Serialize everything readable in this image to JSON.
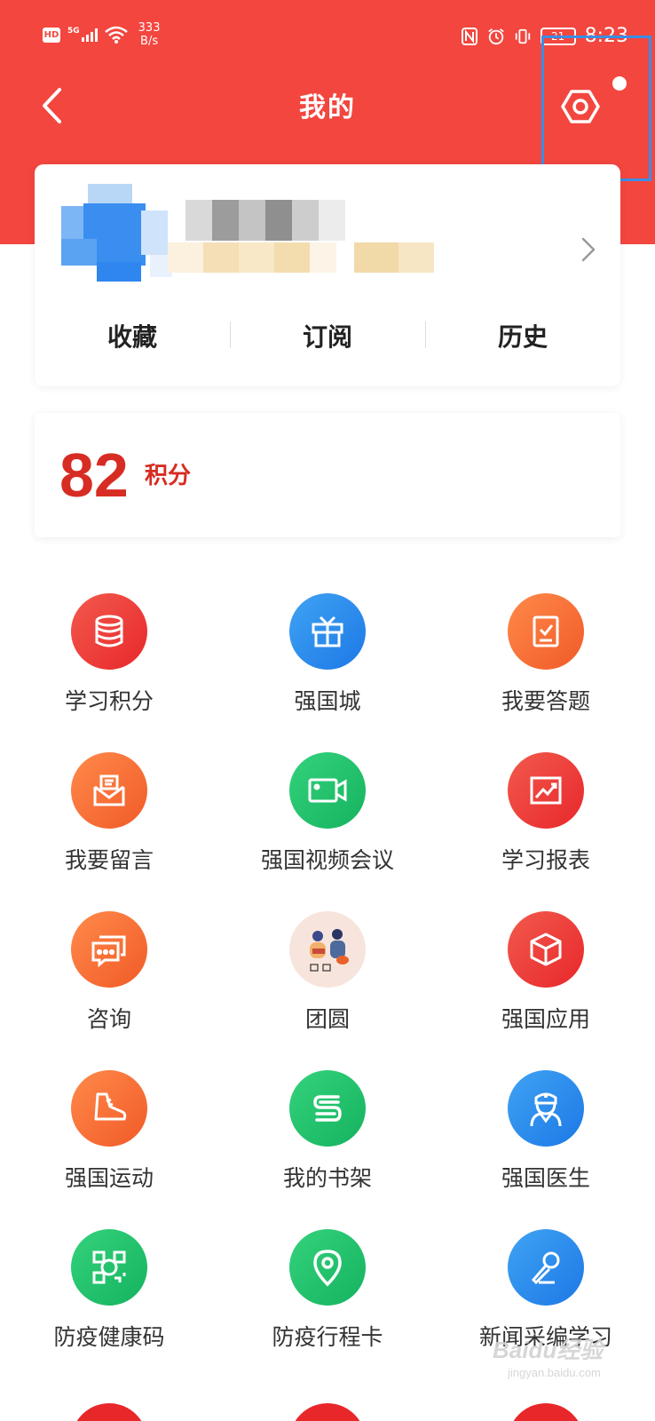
{
  "status_bar": {
    "hd": "HD",
    "network": "5G",
    "speed_value": "333",
    "speed_unit": "B/s",
    "battery": "21",
    "time": "8:23"
  },
  "header": {
    "title": "我的",
    "back_icon": "chevron-left-icon",
    "settings_icon": "hexagon-settings-icon"
  },
  "profile": {
    "tabs": [
      "收藏",
      "订阅",
      "历史"
    ]
  },
  "points": {
    "value": "82",
    "label": "积分"
  },
  "grid": [
    {
      "label": "学习积分",
      "icon": "coin-stack-icon",
      "color": "red"
    },
    {
      "label": "强国城",
      "icon": "gift-box-icon",
      "color": "blue"
    },
    {
      "label": "我要答题",
      "icon": "clipboard-check-icon",
      "color": "orange"
    },
    {
      "label": "我要留言",
      "icon": "envelope-letter-icon",
      "color": "orange"
    },
    {
      "label": "强国视频会议",
      "icon": "video-camera-icon",
      "color": "green"
    },
    {
      "label": "学习报表",
      "icon": "trend-chart-icon",
      "color": "red"
    },
    {
      "label": "咨询",
      "icon": "chat-bubble-icon",
      "color": "orange"
    },
    {
      "label": "团圆",
      "icon": "reunion-illustration-icon",
      "color": "beige"
    },
    {
      "label": "强国应用",
      "icon": "cube-icon",
      "color": "red"
    },
    {
      "label": "强国运动",
      "icon": "running-shoe-icon",
      "color": "orange"
    },
    {
      "label": "我的书架",
      "icon": "bookshelf-icon",
      "color": "green"
    },
    {
      "label": "强国医生",
      "icon": "doctor-icon",
      "color": "blue"
    },
    {
      "label": "防疫健康码",
      "icon": "qr-code-icon",
      "color": "green"
    },
    {
      "label": "防疫行程卡",
      "icon": "location-pin-icon",
      "color": "green"
    },
    {
      "label": "新闻采编学习",
      "icon": "microphone-icon",
      "color": "blue"
    }
  ],
  "watermark": {
    "brand": "Baidu经验",
    "sub": "jingyan.baidu.com"
  }
}
